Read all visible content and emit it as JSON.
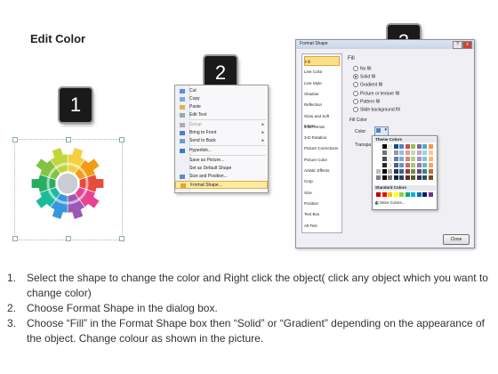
{
  "title": "Edit Color",
  "badges": [
    "1",
    "2",
    "3"
  ],
  "context_menu": {
    "items": [
      {
        "label": "Cut",
        "icon": "scissors-icon",
        "submenu": false,
        "disabled": false,
        "highlight": false
      },
      {
        "label": "Copy",
        "icon": "copy-icon",
        "submenu": false,
        "disabled": false,
        "highlight": false
      },
      {
        "label": "Paste",
        "icon": "paste-icon",
        "submenu": false,
        "disabled": false,
        "highlight": false
      },
      {
        "label": "Edit Text",
        "icon": "edit-text-icon",
        "submenu": false,
        "disabled": false,
        "highlight": false
      },
      {
        "label": "Group",
        "icon": "group-icon",
        "submenu": true,
        "disabled": true,
        "highlight": false
      },
      {
        "label": "Bring to Front",
        "icon": "bring-front-icon",
        "submenu": true,
        "disabled": false,
        "highlight": false
      },
      {
        "label": "Send to Back",
        "icon": "send-back-icon",
        "submenu": true,
        "disabled": false,
        "highlight": false
      },
      {
        "label": "Hyperlink...",
        "icon": "hyperlink-icon",
        "submenu": false,
        "disabled": false,
        "highlight": false
      },
      {
        "label": "Save as Picture...",
        "icon": "",
        "submenu": false,
        "disabled": false,
        "highlight": false
      },
      {
        "label": "Set as Default Shape",
        "icon": "",
        "submenu": false,
        "disabled": false,
        "highlight": false
      },
      {
        "label": "Size and Position...",
        "icon": "size-position-icon",
        "submenu": false,
        "disabled": false,
        "highlight": false
      },
      {
        "label": "Format Shape...",
        "icon": "format-shape-icon",
        "submenu": false,
        "disabled": false,
        "highlight": true
      }
    ]
  },
  "dialog": {
    "title": "Format Shape",
    "window_buttons": [
      "?",
      "x"
    ],
    "nav": [
      "Fill",
      "Line Color",
      "Line Style",
      "Shadow",
      "Reflection",
      "Glow and Soft Edges",
      "3-D Format",
      "3-D Rotation",
      "Picture Corrections",
      "Picture Color",
      "Artistic Effects",
      "Crop",
      "Size",
      "Position",
      "Text Box",
      "Alt Text"
    ],
    "selected_nav": "Fill",
    "fill_heading": "Fill",
    "fill_options": [
      {
        "label": "No fill",
        "checked": false
      },
      {
        "label": "Solid fill",
        "checked": true
      },
      {
        "label": "Gradient fill",
        "checked": false
      },
      {
        "label": "Picture or texture fill",
        "checked": false
      },
      {
        "label": "Pattern fill",
        "checked": false
      },
      {
        "label": "Slide background fill",
        "checked": false
      }
    ],
    "fill_color_heading": "Fill Color",
    "color_label": "Color:",
    "transparency_label": "Transpa",
    "theme_colors_label": "Theme Colors",
    "standard_colors_label": "Standard Colors",
    "more_colors_label": "More Colors...",
    "close_label": "Close"
  },
  "theme_colors": [
    "#ffffff",
    "#000000",
    "#eeece1",
    "#1f497d",
    "#4f81bd",
    "#c0504d",
    "#9bbb59",
    "#8064a2",
    "#4bacc6",
    "#f79646"
  ],
  "standard_colors": [
    "#c00000",
    "#ff0000",
    "#ffc000",
    "#ffff00",
    "#92d050",
    "#00b050",
    "#00b0f0",
    "#0070c0",
    "#002060",
    "#7030a0"
  ],
  "gear_colors": [
    "#f4d03f",
    "#f39c12",
    "#e74c3c",
    "#e84393",
    "#9b59b6",
    "#3498db",
    "#1abc9c",
    "#27ae60",
    "#82c341",
    "#c0d63a"
  ],
  "instructions": [
    {
      "num": "1.",
      "text": "Select the shape to change the color and Right click the object( click any object which you want to change color)"
    },
    {
      "num": "2.",
      "text": "Choose Format Shape in the dialog box."
    },
    {
      "num": "3.",
      "text": "Choose “Fill” in the Format Shape box then “Solid” or “Gradient” depending on the appearance of the object. Change colour as shown in the picture."
    }
  ]
}
